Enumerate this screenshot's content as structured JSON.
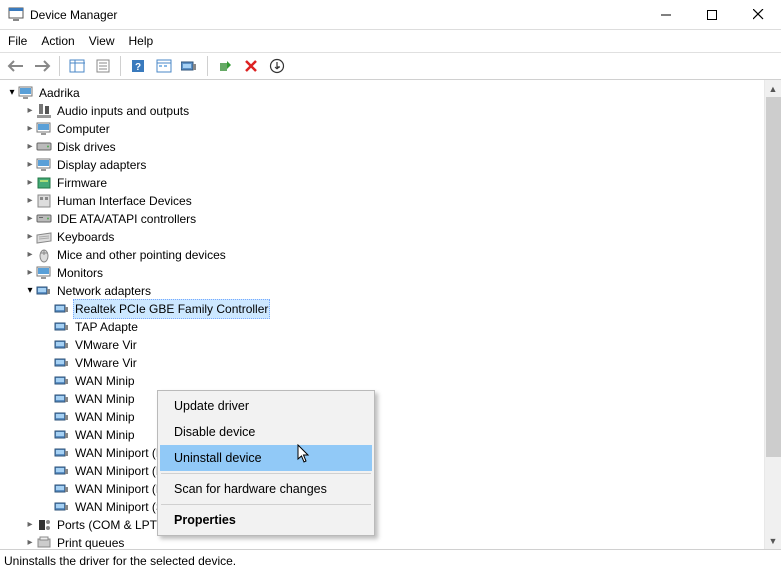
{
  "window": {
    "title": "Device Manager"
  },
  "menu": {
    "file": "File",
    "action": "Action",
    "view": "View",
    "help": "Help"
  },
  "tree": {
    "root": "Aadrika",
    "items": [
      "Audio inputs and outputs",
      "Computer",
      "Disk drives",
      "Display adapters",
      "Firmware",
      "Human Interface Devices",
      "IDE ATA/ATAPI controllers",
      "Keyboards",
      "Mice and other pointing devices",
      "Monitors",
      "Network adapters",
      "Ports (COM & LPT)",
      "Print queues"
    ],
    "network": [
      "Realtek PCIe GBE Family Controller",
      "TAP Adapte",
      "VMware Vir",
      "VMware Vir",
      "WAN Minip",
      "WAN Minip",
      "WAN Minip",
      "WAN Minip",
      "WAN Miniport (Network Monitor)",
      "WAN Miniport (PPPOE)",
      "WAN Miniport (PPTP)",
      "WAN Miniport (SSTP)"
    ]
  },
  "context": {
    "update": "Update driver",
    "disable": "Disable device",
    "uninstall": "Uninstall device",
    "scan": "Scan for hardware changes",
    "properties": "Properties"
  },
  "status": "Uninstalls the driver for the selected device."
}
